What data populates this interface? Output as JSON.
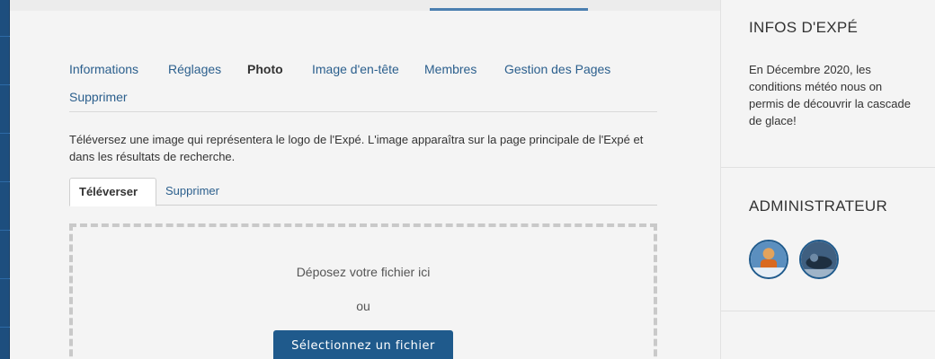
{
  "nav": {
    "items": [
      {
        "label": "Informations",
        "active": false
      },
      {
        "label": "Réglages",
        "active": false
      },
      {
        "label": "Photo",
        "active": true
      },
      {
        "label": "Image d'en-tête",
        "active": false
      },
      {
        "label": "Membres",
        "active": false
      },
      {
        "label": "Gestion des Pages",
        "active": false
      },
      {
        "label": "Supprimer",
        "active": false
      }
    ]
  },
  "description": "Téléversez une image qui représentera le logo de l'Expé. L'image apparaîtra sur la page principale de l'Expé et dans les résultats de recherche.",
  "subtabs": {
    "upload": "Téléverser",
    "delete": "Supprimer"
  },
  "dropzone": {
    "drop_text": "Déposez votre fichier ici",
    "or_text": "ou",
    "button_label": "Sélectionnez un fichier"
  },
  "sidebar": {
    "info_title": "INFOS D'EXPÉ",
    "info_body": "En Décembre 2020, les conditions météo nous on permis de découvrir la cascade de glace!",
    "admin_title": "ADMINISTRATEUR",
    "admins": [
      {
        "icon": "admin-avatar-icon"
      },
      {
        "icon": "admin-avatar-icon"
      }
    ]
  },
  "colors": {
    "link": "#2b5f8d",
    "button": "#1f5a8c",
    "strip": "#1d4e7e"
  }
}
